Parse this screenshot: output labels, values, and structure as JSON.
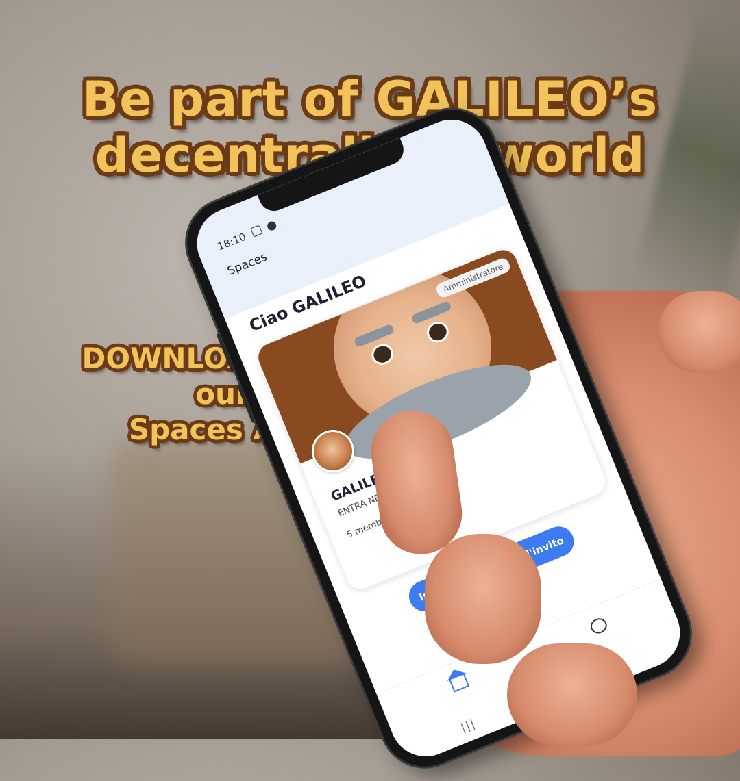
{
  "ad": {
    "headline_line1": "Be part of GALILEO’s",
    "headline_line2": "decentralized world",
    "cta_line1": "DOWNLOAD NOW",
    "cta_line2": "our",
    "cta_line3": "Spaces App"
  },
  "phone": {
    "status_time": "18:10",
    "app_title": "Spaces",
    "greeting": "Ciao GALILEO",
    "card": {
      "role_badge": "Amministratore",
      "space_name": "GALILEO APP",
      "space_description": "ENTRA NEL VIVO DI GALILEO",
      "members": "5 membri"
    },
    "invite_button": "Iscriviti con codice d'invito",
    "nav": {
      "home_icon": "home-icon",
      "chat_icon": "chat-icon"
    },
    "system_bar": {
      "recent": "|||"
    }
  },
  "colors": {
    "headline_fill": "#f1c35a",
    "headline_outline": "#6b3a16",
    "accent_blue": "#3d7bf0"
  }
}
